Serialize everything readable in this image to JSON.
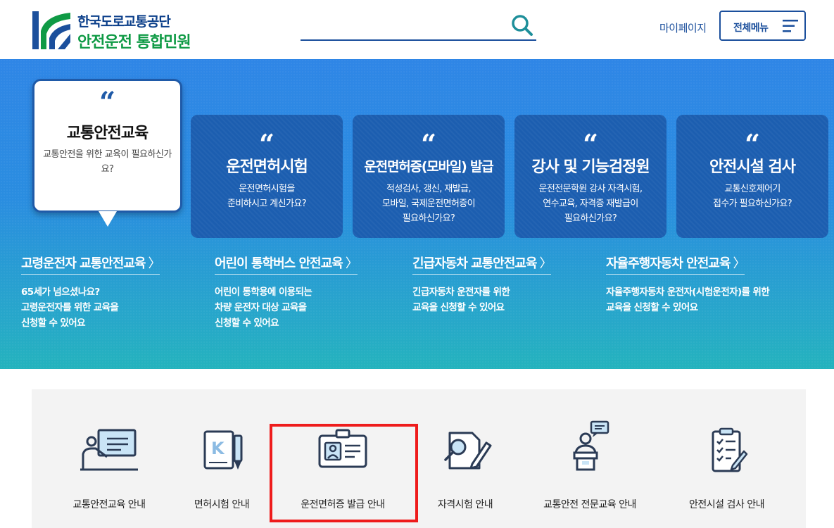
{
  "header": {
    "org_name": "한국도로교통공단",
    "site_name": "안전운전 통합민원",
    "search_placeholder": "",
    "mypage_label": "마이페이지",
    "allmenu_label": "전체메뉴"
  },
  "hero": {
    "quote_mark": "“",
    "featured": {
      "title": "교통안전교육",
      "desc": "교통안전을 위한 교육이 필요하신가요?"
    },
    "cards": [
      {
        "title": "운전면허시험",
        "desc": "운전면허시험을\n준비하시고 계신가요?"
      },
      {
        "title": "운전면허증(모바일) 발급",
        "desc": "적성검사, 갱신, 재발급,\n모바일, 국제운전면허증이\n필요하신가요?"
      },
      {
        "title": "강사 및 기능검정원",
        "desc": "운전전문학원 강사 자격시험,\n연수교육, 자격증 재발급이\n필요하신가요?"
      },
      {
        "title": "안전시설 검사",
        "desc": "교통신호제어기\n접수가 필요하신가요?"
      }
    ],
    "subs": [
      {
        "title": "고령운전자 교통안전교육",
        "desc": "65세가 넘으셨나요?\n고령운전자를 위한 교육을\n신청할 수 있어요"
      },
      {
        "title": "어린이 통학버스 안전교육",
        "desc": "어린이 통학용에 이용되는\n차량 운전자 대상 교육을\n신청할 수 있어요"
      },
      {
        "title": "긴급자동차 교통안전교육",
        "desc": "긴급자동차 운전자를 위한\n교육을 신청할 수 있어요"
      },
      {
        "title": "자율주행자동차 안전교육",
        "desc": "자율주행자동차 운전자(시험운전자)를 위한\n교육을 신청할 수 있어요"
      }
    ],
    "arrow": "〉"
  },
  "quick_links": [
    {
      "label": "교통안전교육 안내",
      "icon": "presentation-teacher-icon"
    },
    {
      "label": "면허시험 안내",
      "icon": "exam-document-pen-icon"
    },
    {
      "label": "운전면허증 발급 안내",
      "icon": "license-card-icon"
    },
    {
      "label": "자격시험 안내",
      "icon": "qualification-search-icon"
    },
    {
      "label": "교통안전 전문교육 안내",
      "icon": "lecturer-podium-icon"
    },
    {
      "label": "안전시설 검사 안내",
      "icon": "checklist-clipboard-icon"
    }
  ],
  "colors": {
    "brand_navy": "#1b4f9c",
    "brand_green": "#0f9a45",
    "card_blue": "#1c5eb0",
    "highlight_red": "#ee1c1c"
  }
}
